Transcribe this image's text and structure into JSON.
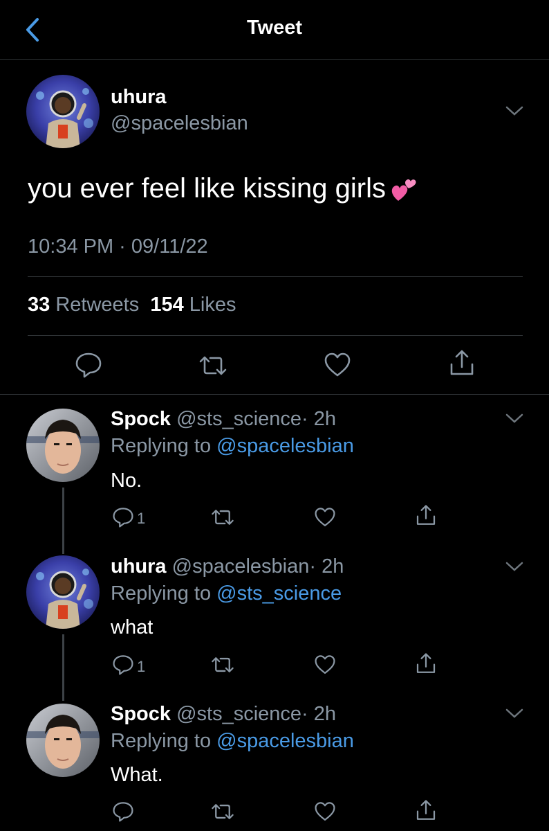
{
  "header": {
    "title": "Tweet"
  },
  "main_tweet": {
    "name": "uhura",
    "handle": "@spacelesbian",
    "text": "you ever feel like kissing girls",
    "emoji_icon": "two-hearts-icon",
    "timestamp": "10:34 PM · 09/11/22",
    "retweets_count": "33",
    "retweets_label": "Retweets",
    "likes_count": "154",
    "likes_label": "Likes"
  },
  "replies": [
    {
      "name": "Spock",
      "handle": "@sts_science",
      "time": "· 2h",
      "replying_label": "Replying to",
      "replying_to": "@spacelesbian",
      "text": "No.",
      "reply_count": "1"
    },
    {
      "name": "uhura",
      "handle": "@spacelesbian",
      "time": "· 2h",
      "replying_label": "Replying to",
      "replying_to": "@sts_science",
      "text": "what",
      "reply_count": "1"
    },
    {
      "name": "Spock",
      "handle": "@sts_science",
      "time": "· 2h",
      "replying_label": "Replying to",
      "replying_to": "@spacelesbian",
      "text": "What.",
      "reply_count": ""
    }
  ],
  "colors": {
    "background": "#000000",
    "secondary_text": "#8b98a5",
    "accent": "#4a9be6",
    "divider": "#2f3336"
  }
}
